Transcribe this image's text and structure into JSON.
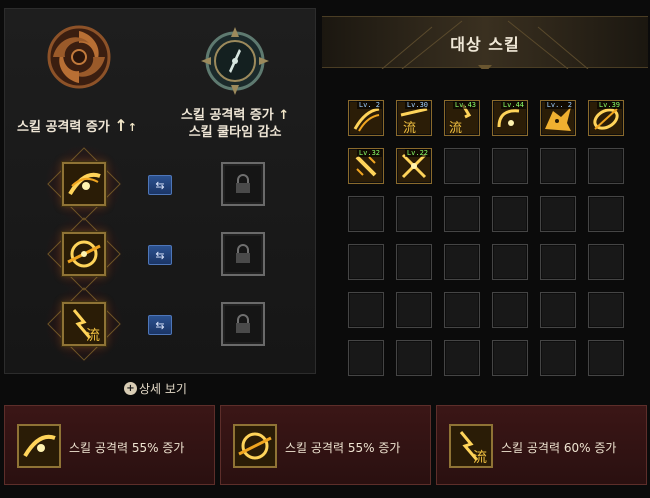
{
  "left": {
    "col1_label": "스킬 공격력 증가",
    "col2_label_line1": "스킬 공격력 증가",
    "col2_label_line2": "스킬 쿨타임 감소",
    "arrow_symbol": "↑",
    "rows": [
      {
        "skill_icon": "swoosh-slash-icon",
        "swap_icon": "swap-arrows-icon",
        "lock_icon": "lock-icon"
      },
      {
        "skill_icon": "spiral-slash-icon",
        "swap_icon": "swap-arrows-icon",
        "lock_icon": "lock-icon"
      },
      {
        "skill_icon": "flow-strike-icon",
        "swap_icon": "swap-arrows-icon",
        "lock_icon": "lock-icon"
      }
    ],
    "detail_link": "상세 보기"
  },
  "right": {
    "title": "대상 스킬",
    "skills": [
      {
        "level": "Lv. 2",
        "level_color": "blue",
        "icon": "claw-slash-icon"
      },
      {
        "level": "Lv.30",
        "level_color": "blue",
        "icon": "flow-wing-icon"
      },
      {
        "level": "Lv.43",
        "level_color": "green",
        "icon": "flow-strike-icon"
      },
      {
        "level": "Lv.44",
        "level_color": "green",
        "icon": "arc-slash-icon"
      },
      {
        "level": "Lv.. 2",
        "level_color": "blue",
        "icon": "beast-roar-icon"
      },
      {
        "level": "Lv.39",
        "level_color": "green",
        "icon": "whirl-slash-icon"
      },
      {
        "level": "Lv.32",
        "level_color": "green",
        "icon": "sword-burst-icon"
      },
      {
        "level": "Lv.22",
        "level_color": "green",
        "icon": "cross-blade-icon"
      }
    ],
    "empty_slots": 28
  },
  "banners": [
    {
      "text": "스킬 공격력 55% 증가",
      "icon": "swoosh-slash-icon"
    },
    {
      "text": "스킬 공격력 55% 증가",
      "icon": "spiral-slash-icon"
    },
    {
      "text": "스킬 공격력 60% 증가",
      "icon": "flow-strike-icon"
    }
  ],
  "colors": {
    "accent_gold": "#c9a24a",
    "banner_red": "#3b1616",
    "swap_blue": "#2c5290",
    "level_green": "#8cff6a",
    "level_blue": "#9fd0ff"
  }
}
